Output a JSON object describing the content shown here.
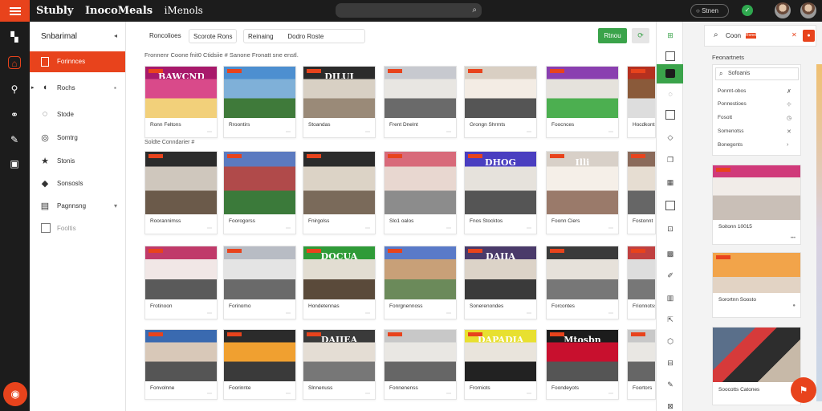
{
  "header": {
    "brand": [
      "Stubly",
      "InocoMeals",
      "iMenols"
    ],
    "pill_label": "Stnen"
  },
  "sidebar": {
    "title": "Snbarimal",
    "active_label": "Forinnces",
    "items": [
      {
        "label": "Rochs",
        "icon": "chat-icon"
      },
      {
        "label": "Stode",
        "icon": "location-icon"
      },
      {
        "label": "Somtrg",
        "icon": "spinner-icon"
      },
      {
        "label": "Stonis",
        "icon": "star-icon"
      },
      {
        "label": "Sonsosls",
        "icon": "tag-icon"
      },
      {
        "label": "Pagnnsng",
        "icon": "image-icon"
      },
      {
        "label": "Fooltis",
        "icon": "checkbox-icon"
      }
    ]
  },
  "filters": {
    "chip1": "Roncolioes",
    "chip2": "Scorote Rons",
    "chip3": "Reinaing",
    "chip4": "Dodro Roste",
    "primary_btn": "Rtnou"
  },
  "breadcrumb": "Fronnenr Coone fnit0 Ctidsiie # Sanone Fronatt sne enstl.",
  "section2_label": "Soldte Conndarier #",
  "cards": [
    [
      "Ronn Feltons",
      "Rroontirs",
      "Stoandas",
      "Frent Dnelnt",
      "Grongn Shrrnts",
      "Foocnces",
      "Hocdkonts"
    ],
    [
      "Roorannimss",
      "Foorogorss",
      "Fnirgolss",
      "Slo1 oalos",
      "Fnos Stocktos",
      "Foonn Ciers",
      "Fostonnt"
    ],
    [
      "Frotinoon",
      "Forinomo",
      "Hondetennas",
      "Fonrgnennoss",
      "Sonerenondes",
      "Forcontes",
      "Frionnotss"
    ],
    [
      "Fonvolnne",
      "Foorinnte",
      "Slnnenuss",
      "Fonnenenss",
      "Frorniots",
      "Foondeyots",
      "Foortors"
    ]
  ],
  "signs": [
    "BAWCNDE",
    "",
    "DILUI",
    "",
    "",
    "",
    "",
    "",
    "",
    "",
    "",
    "DHOG",
    "Illi",
    "",
    "",
    "",
    "DOCUA",
    "",
    "DAIIA",
    "",
    "",
    "",
    "",
    "DAIIEA",
    "",
    "DAPADIA",
    "Mtosbn",
    ""
  ],
  "rpanel": {
    "title": "Coon",
    "badge": "Ronel",
    "section": "Feonartnets",
    "search": "Sofoanis",
    "rows": [
      "Ponrnt-obos",
      "Ponnestioes",
      "Fosott",
      "Somenotss",
      "Bonegonts"
    ],
    "cards": [
      "Soitonn 10015",
      "Sorortnn Soosto",
      "Soocotts Catones"
    ]
  },
  "icons": {
    "menu": "hamburger-icon",
    "search": "search-icon",
    "chevron": "chevron-down-icon"
  },
  "colors": {
    "accent": "#e8431c",
    "green": "#3aa34a",
    "dark": "#1c1c1c"
  }
}
